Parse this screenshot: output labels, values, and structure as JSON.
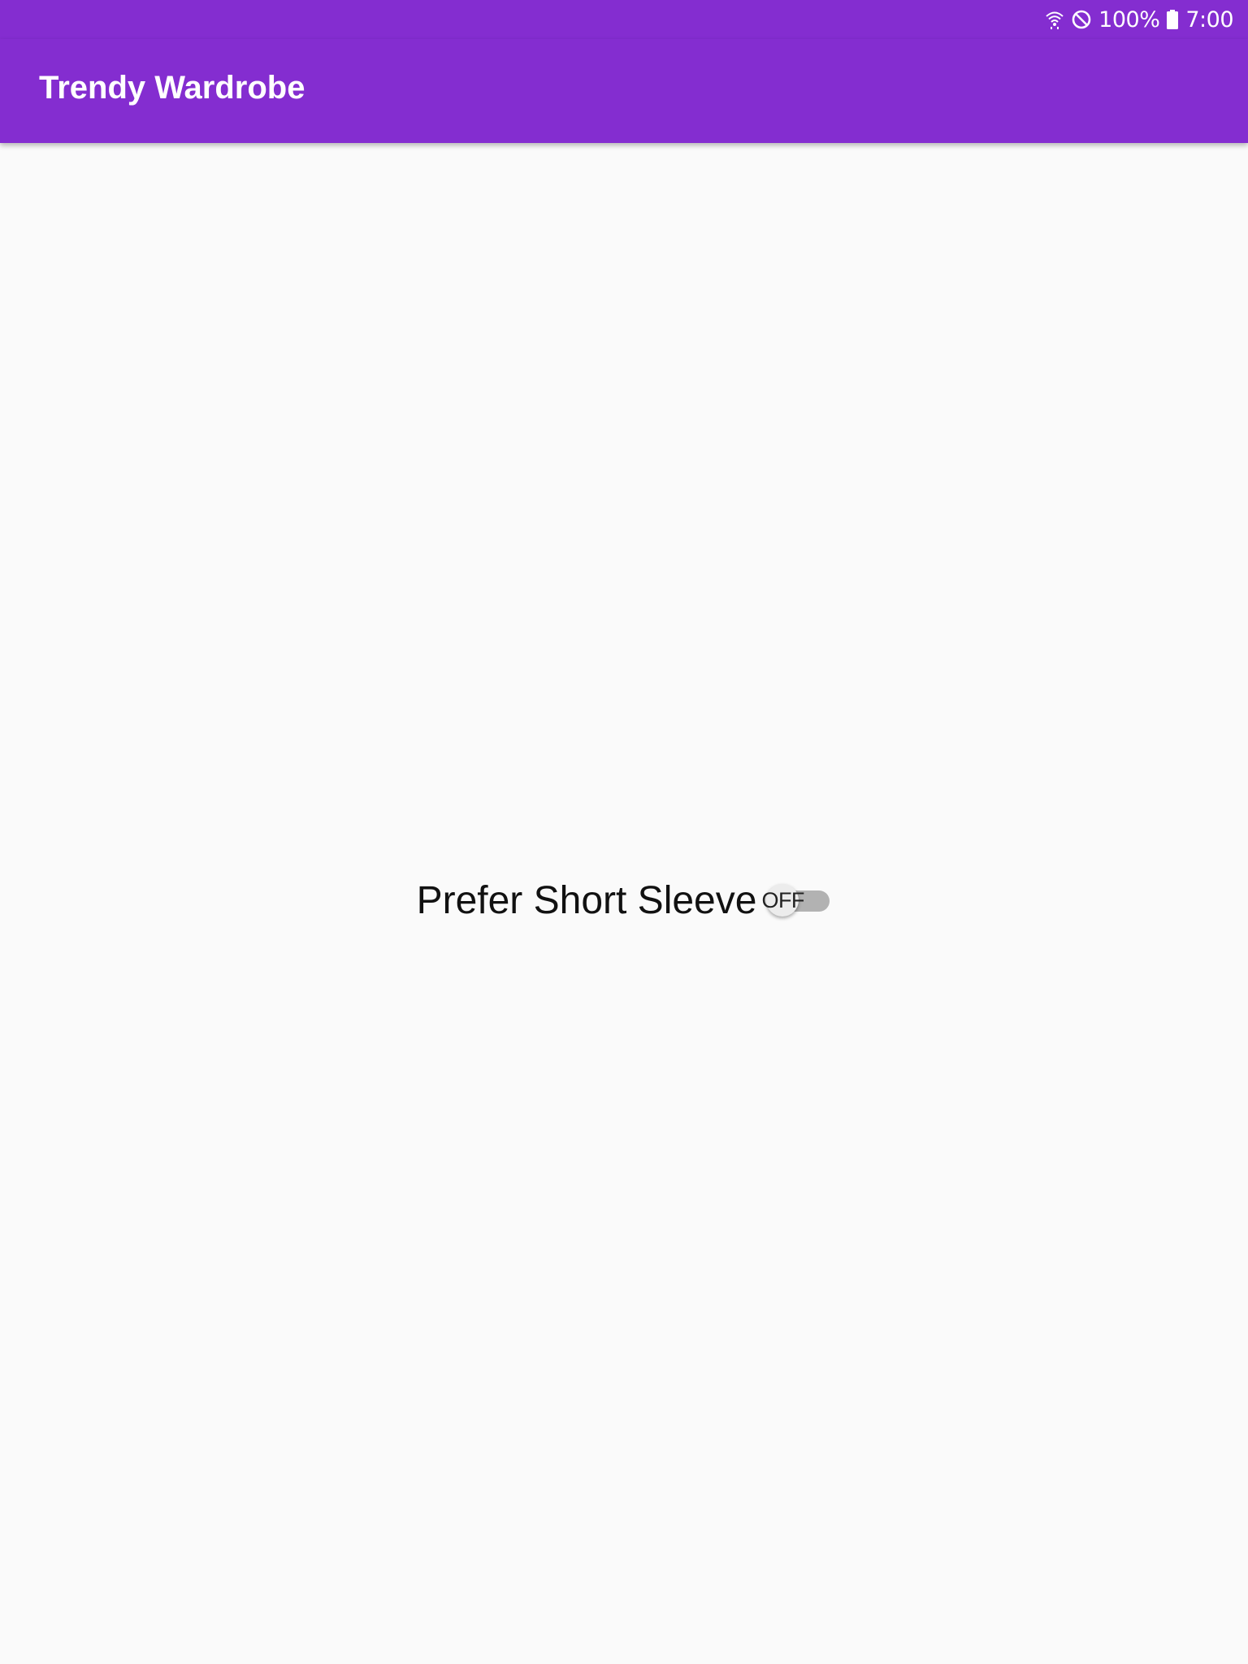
{
  "status_bar": {
    "icons": [
      "wifi-icon",
      "do-not-disturb-icon",
      "battery-icon"
    ],
    "battery_text": "100%",
    "time": "7:00"
  },
  "app_bar": {
    "title": "Trendy Wardrobe"
  },
  "main": {
    "switch_label": "Prefer Short Sleeve",
    "switch_state_text": "OFF",
    "switch_on": false
  },
  "colors": {
    "primary": "#842dd0",
    "background": "#fafafa",
    "switch_track": "#b2b2b2",
    "switch_thumb": "#ececec"
  }
}
